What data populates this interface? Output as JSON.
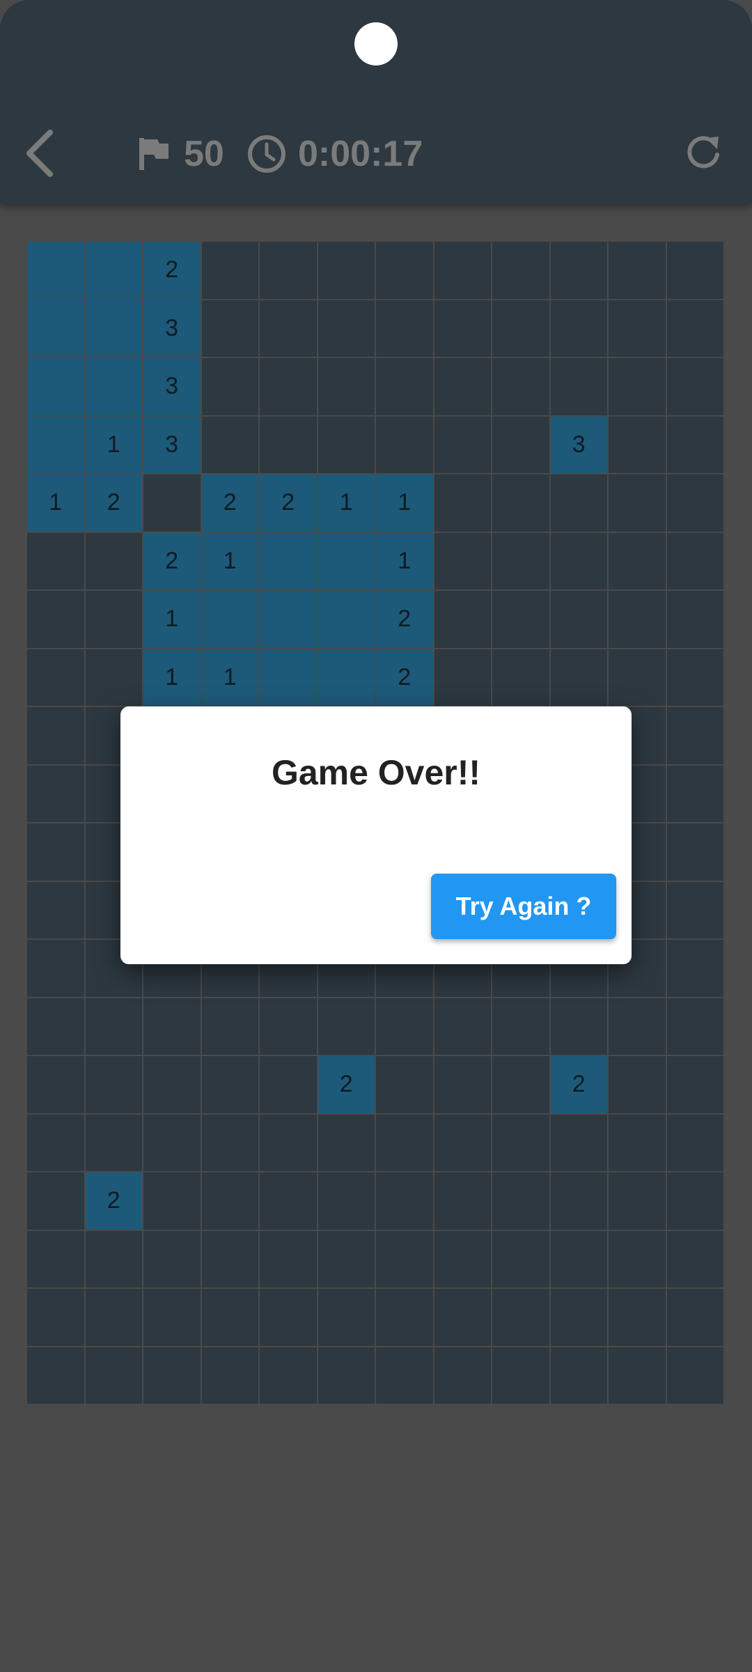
{
  "header": {
    "flag_count": "50",
    "timer": "0:00:17",
    "icon_color": "#7b7b7b",
    "icons": [
      "back-arrow-icon",
      "flag-icon",
      "clock-icon",
      "refresh-icon"
    ]
  },
  "board": {
    "rows": 20,
    "cols": 12,
    "colors": {
      "hidden": "#2d3840",
      "revealed": "#1d5a7a",
      "grid": "#4a4a4a"
    },
    "revealed_cells": [
      {
        "r": 0,
        "c": 0,
        "label": ""
      },
      {
        "r": 0,
        "c": 1,
        "label": ""
      },
      {
        "r": 0,
        "c": 2,
        "label": "2"
      },
      {
        "r": 1,
        "c": 0,
        "label": ""
      },
      {
        "r": 1,
        "c": 1,
        "label": ""
      },
      {
        "r": 1,
        "c": 2,
        "label": "3"
      },
      {
        "r": 2,
        "c": 0,
        "label": ""
      },
      {
        "r": 2,
        "c": 1,
        "label": ""
      },
      {
        "r": 2,
        "c": 2,
        "label": "3"
      },
      {
        "r": 3,
        "c": 0,
        "label": ""
      },
      {
        "r": 3,
        "c": 1,
        "label": "1"
      },
      {
        "r": 3,
        "c": 2,
        "label": "3"
      },
      {
        "r": 3,
        "c": 9,
        "label": "3"
      },
      {
        "r": 4,
        "c": 0,
        "label": "1"
      },
      {
        "r": 4,
        "c": 1,
        "label": "2"
      },
      {
        "r": 4,
        "c": 3,
        "label": "2"
      },
      {
        "r": 4,
        "c": 4,
        "label": "2"
      },
      {
        "r": 4,
        "c": 5,
        "label": "1"
      },
      {
        "r": 4,
        "c": 6,
        "label": "1"
      },
      {
        "r": 5,
        "c": 2,
        "label": "2"
      },
      {
        "r": 5,
        "c": 3,
        "label": "1"
      },
      {
        "r": 5,
        "c": 4,
        "label": ""
      },
      {
        "r": 5,
        "c": 5,
        "label": ""
      },
      {
        "r": 5,
        "c": 6,
        "label": "1"
      },
      {
        "r": 6,
        "c": 2,
        "label": "1"
      },
      {
        "r": 6,
        "c": 3,
        "label": ""
      },
      {
        "r": 6,
        "c": 4,
        "label": ""
      },
      {
        "r": 6,
        "c": 5,
        "label": ""
      },
      {
        "r": 6,
        "c": 6,
        "label": "2"
      },
      {
        "r": 7,
        "c": 2,
        "label": "1"
      },
      {
        "r": 7,
        "c": 3,
        "label": "1"
      },
      {
        "r": 7,
        "c": 4,
        "label": ""
      },
      {
        "r": 7,
        "c": 5,
        "label": ""
      },
      {
        "r": 7,
        "c": 6,
        "label": "2"
      },
      {
        "r": 14,
        "c": 5,
        "label": "2"
      },
      {
        "r": 14,
        "c": 9,
        "label": "2"
      },
      {
        "r": 16,
        "c": 1,
        "label": "2"
      }
    ]
  },
  "dialog": {
    "title": "Game Over!!",
    "button_label": "Try Again ?",
    "button_color": "#2196f3"
  }
}
